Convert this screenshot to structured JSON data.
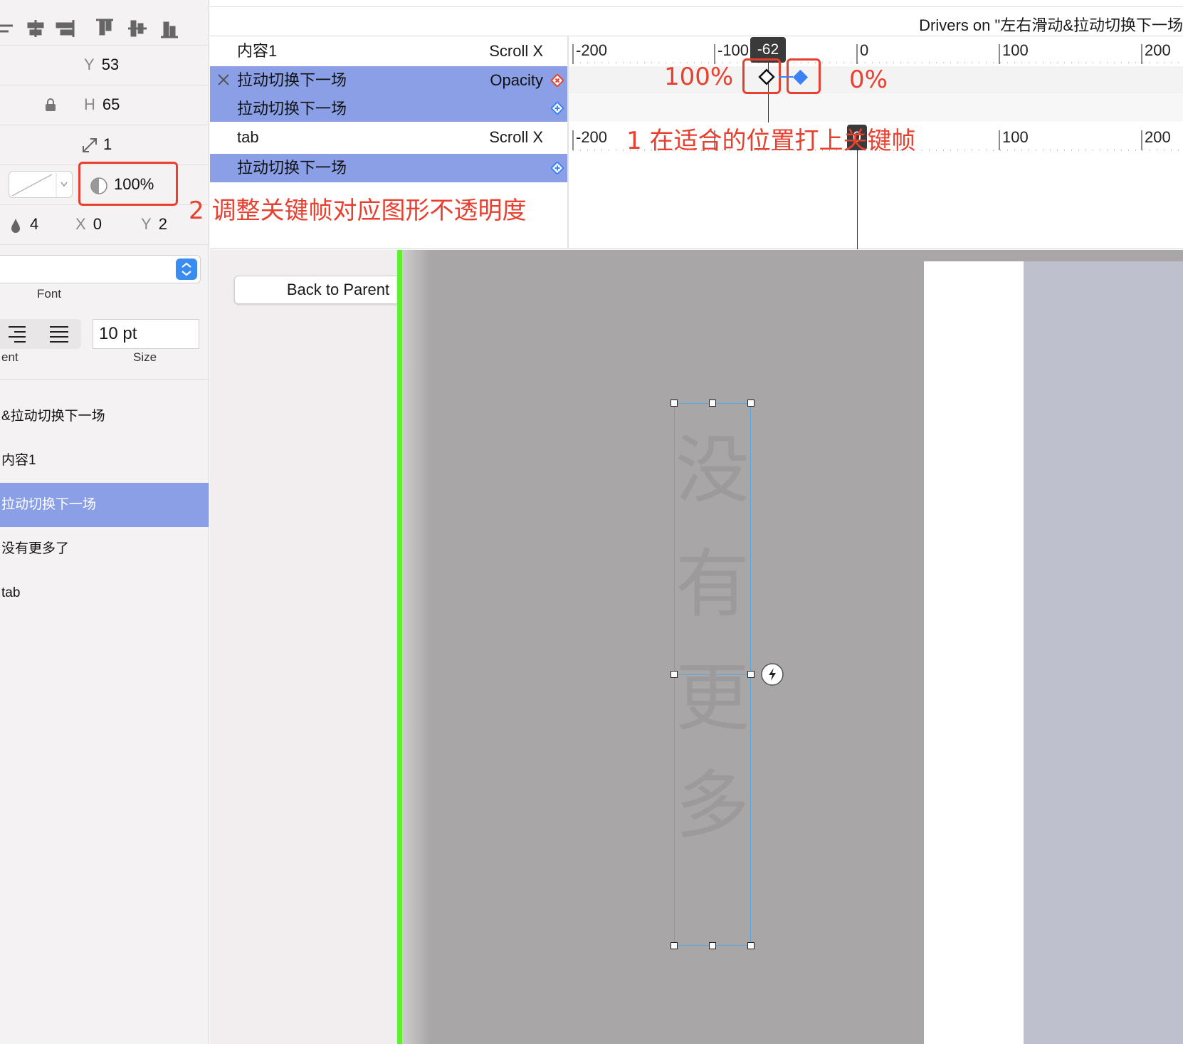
{
  "window": {
    "title": "Drivers on \"左右滑动&拉动切换下一场"
  },
  "inspector": {
    "y_label": "Y",
    "y_value": "53",
    "h_label": "H",
    "h_value": "65",
    "scale_value": "1",
    "opacity_value": "100%",
    "shadow_blur": "4",
    "shadow_x_label": "X",
    "shadow_x": "0",
    "shadow_y_label": "Y",
    "shadow_y": "2",
    "font_label": "Font",
    "alignment_label_partial": "ent",
    "font_size_value": "10 pt",
    "size_label": "Size"
  },
  "layers": [
    {
      "label": "&拉动切换下一场",
      "selected": false
    },
    {
      "label": "内容1",
      "selected": false
    },
    {
      "label": "拉动切换下一场",
      "selected": true
    },
    {
      "label": "没有更多了",
      "selected": false
    },
    {
      "label": "tab",
      "selected": false
    }
  ],
  "timeline": {
    "rows": [
      {
        "name": "内容1",
        "property": "Scroll X"
      },
      {
        "name": "拉动切换下一场",
        "property": "Opacity"
      },
      {
        "name": "拉动切换下一场",
        "property": ""
      },
      {
        "name": "tab",
        "property": "Scroll X"
      },
      {
        "name": "拉动切换下一场",
        "property": ""
      }
    ],
    "ruler_ticks": [
      "-200",
      "-100",
      "0",
      "100",
      "200"
    ],
    "ruler2_ticks": [
      "-200",
      "100",
      "200"
    ],
    "playhead_value": "-62",
    "playhead2_value": "0",
    "keyframe_left_pct": "100%",
    "keyframe_right_pct": "0%"
  },
  "annotations": {
    "note1": "1 在适合的位置打上关键帧",
    "note2": "2 调整关键帧对应图形不透明度"
  },
  "canvas": {
    "back_button_label": "Back to Parent",
    "vertical_text": [
      "没",
      "有",
      "更",
      "多"
    ]
  },
  "colors": {
    "selection": "#8a9fe6",
    "annotation_red": "#e8402f",
    "green_guide": "#5df02e",
    "keyframe_blue": "#3b82f6"
  }
}
